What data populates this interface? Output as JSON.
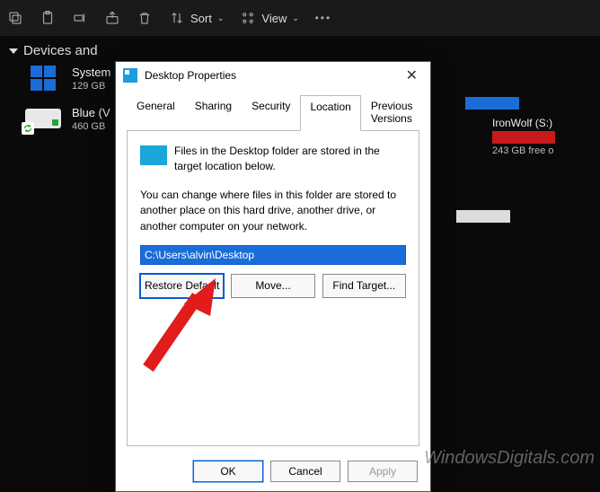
{
  "toolbar": {
    "sort_label": "Sort",
    "view_label": "View"
  },
  "sidebar": {
    "header": "Devices and",
    "drives": [
      {
        "name": "System",
        "size": "129 GB"
      },
      {
        "name": "Blue (V",
        "size": "460 GB"
      }
    ]
  },
  "right": {
    "drive_label": "IronWolf (S:)",
    "drive_size": "243 GB free o"
  },
  "dialog": {
    "title": "Desktop Properties",
    "tabs": {
      "general": "General",
      "sharing": "Sharing",
      "security": "Security",
      "location": "Location",
      "previous": "Previous Versions"
    },
    "loc_desc1": "Files in the Desktop folder are stored in the target location below.",
    "loc_desc2": "You can change where files in this folder are stored to another place on this hard drive, another drive, or another computer on your network.",
    "path": "C:\\Users\\alvin\\Desktop",
    "restore": "Restore Default",
    "move": "Move...",
    "find": "Find Target...",
    "ok": "OK",
    "cancel": "Cancel",
    "apply": "Apply"
  },
  "watermark": "WindowsDigitals.com"
}
